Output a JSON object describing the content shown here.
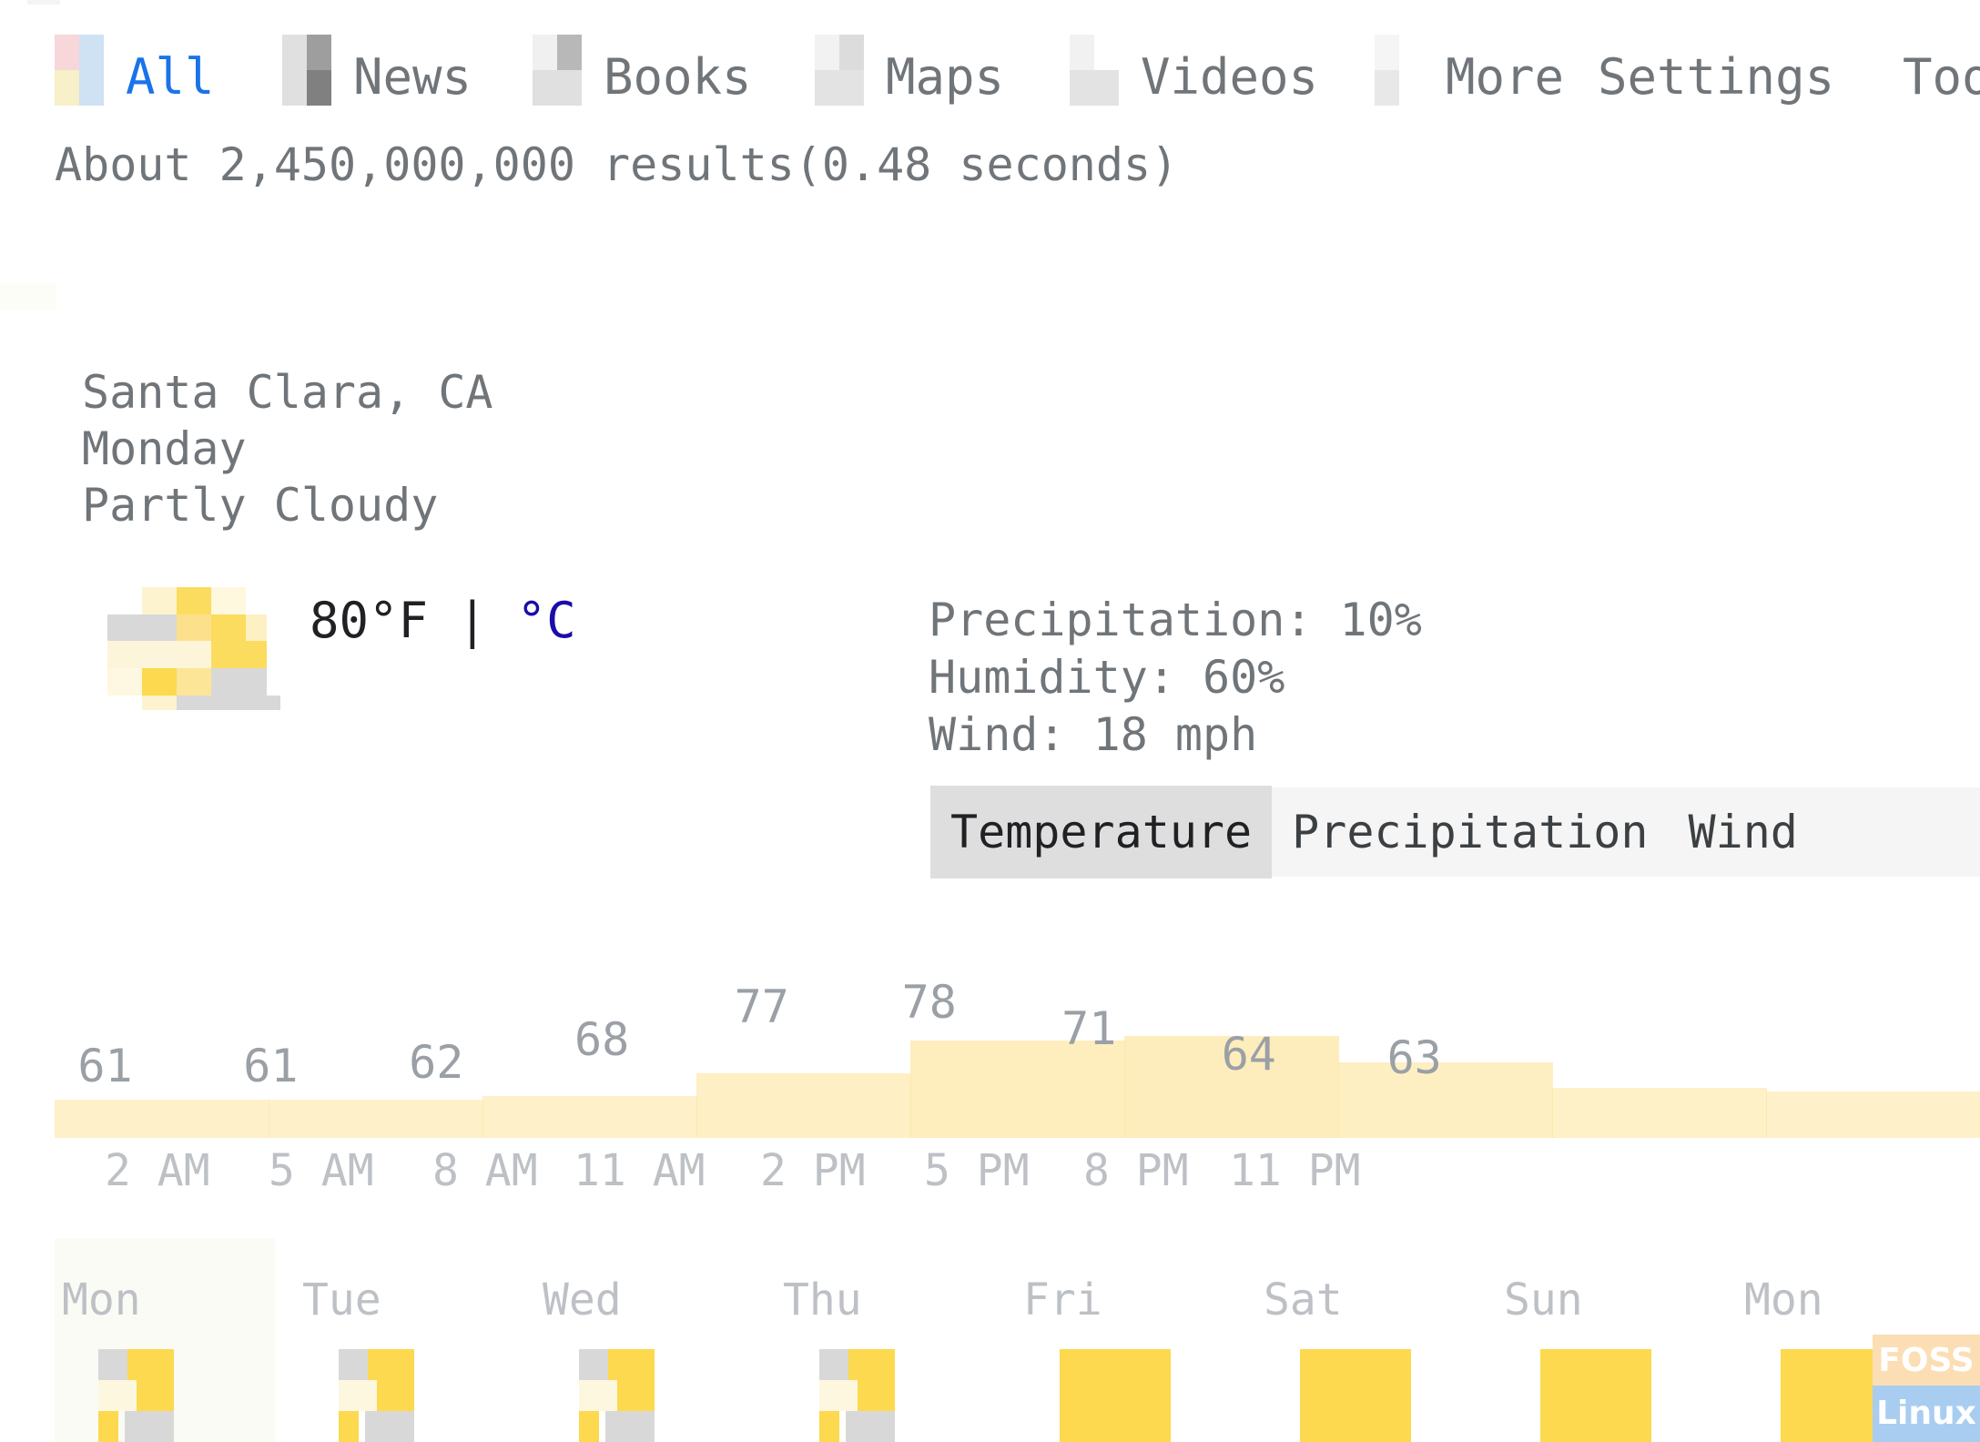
{
  "nav": {
    "items": [
      {
        "label": "All",
        "icon": "all-icon",
        "active": true,
        "colors": [
          "#f8d7da",
          "#cfe2f3",
          "#f7f0c8",
          "#cfe2f3"
        ]
      },
      {
        "label": "News",
        "icon": "news-icon",
        "active": false,
        "colors": [
          "#e0e0e0",
          "#9e9e9e",
          "#e0e0e0",
          "#808080"
        ]
      },
      {
        "label": "Books",
        "icon": "books-icon",
        "active": false,
        "colors": [
          "#f0f0f0",
          "#b8b8b8",
          "#e0e0e0",
          "#e0e0e0"
        ]
      },
      {
        "label": "Maps",
        "icon": "maps-icon",
        "active": false,
        "colors": [
          "#f2f2f2",
          "#dcdcdc",
          "#e3e3e3",
          "#e3e3e3"
        ]
      },
      {
        "label": "Videos",
        "icon": "videos-icon",
        "active": false,
        "colors": [
          "#f1f1f1",
          "#ffffff",
          "#e3e3e3",
          "#e3e3e3"
        ]
      },
      {
        "label": "More",
        "icon": "more-icon",
        "active": false,
        "colors": [
          "#f5f5f5",
          "#ffffff",
          "#e8e8e8",
          "#ffffff"
        ]
      },
      {
        "label": "Settings",
        "icon": "",
        "active": false,
        "colors": []
      },
      {
        "label": "Tools",
        "icon": "",
        "active": false,
        "colors": []
      }
    ]
  },
  "results_line": "About 2,450,000,000 results(0.48 seconds)",
  "weather": {
    "location": "Santa Clara, CA",
    "day": "Monday",
    "condition": "Partly Cloudy",
    "temperature": "80°F",
    "separator": "|",
    "unit_alt": "°C",
    "precipitation": "Precipitation: 10%",
    "humidity": "Humidity: 60%",
    "wind": "Wind: 18 mph",
    "accent_color": "#1a0dab",
    "bar_color": "#fde293",
    "tabs": [
      {
        "label": "Temperature",
        "active": true
      },
      {
        "label": "Precipitation",
        "active": false
      },
      {
        "label": "Wind",
        "active": false
      }
    ]
  },
  "chart_data": {
    "type": "area",
    "title": "Temperature",
    "xlabel": "",
    "ylabel": "°F",
    "ylim": [
      55,
      85
    ],
    "grid": false,
    "legend": "none",
    "categories": [
      "2 AM",
      "5 AM",
      "8 AM",
      "11 AM",
      "2 PM",
      "5 PM",
      "8 PM",
      "11 PM"
    ],
    "labeled_points": [
      {
        "label": "61",
        "value": 61,
        "x_frac": 0.012
      },
      {
        "label": "61",
        "value": 61,
        "x_frac": 0.098
      },
      {
        "label": "62",
        "value": 62,
        "x_frac": 0.184
      },
      {
        "label": "68",
        "value": 68,
        "x_frac": 0.27
      },
      {
        "label": "77",
        "value": 77,
        "x_frac": 0.353
      },
      {
        "label": "78",
        "value": 78,
        "x_frac": 0.44
      },
      {
        "label": "71",
        "value": 71,
        "x_frac": 0.523
      },
      {
        "label": "64",
        "value": 64,
        "x_frac": 0.606
      },
      {
        "label": "63",
        "value": 63,
        "x_frac": 0.692
      }
    ],
    "values": [
      61,
      61,
      62,
      68,
      77,
      78,
      71,
      64,
      63
    ],
    "units": "°F"
  },
  "forecast": {
    "days": [
      {
        "name": "Mon",
        "icon": "partly-cloudy-icon",
        "today": true
      },
      {
        "name": "Tue",
        "icon": "partly-cloudy-icon",
        "today": false
      },
      {
        "name": "Wed",
        "icon": "partly-cloudy-icon",
        "today": false
      },
      {
        "name": "Thu",
        "icon": "partly-cloudy-icon",
        "today": false
      },
      {
        "name": "Fri",
        "icon": "sunny-icon",
        "today": false
      },
      {
        "name": "Sat",
        "icon": "sunny-icon",
        "today": false
      },
      {
        "name": "Sun",
        "icon": "sunny-icon",
        "today": false
      },
      {
        "name": "Mon",
        "icon": "sunny-icon",
        "today": false
      }
    ]
  },
  "watermark": {
    "top": "FOSS",
    "bottom": "Linux"
  }
}
